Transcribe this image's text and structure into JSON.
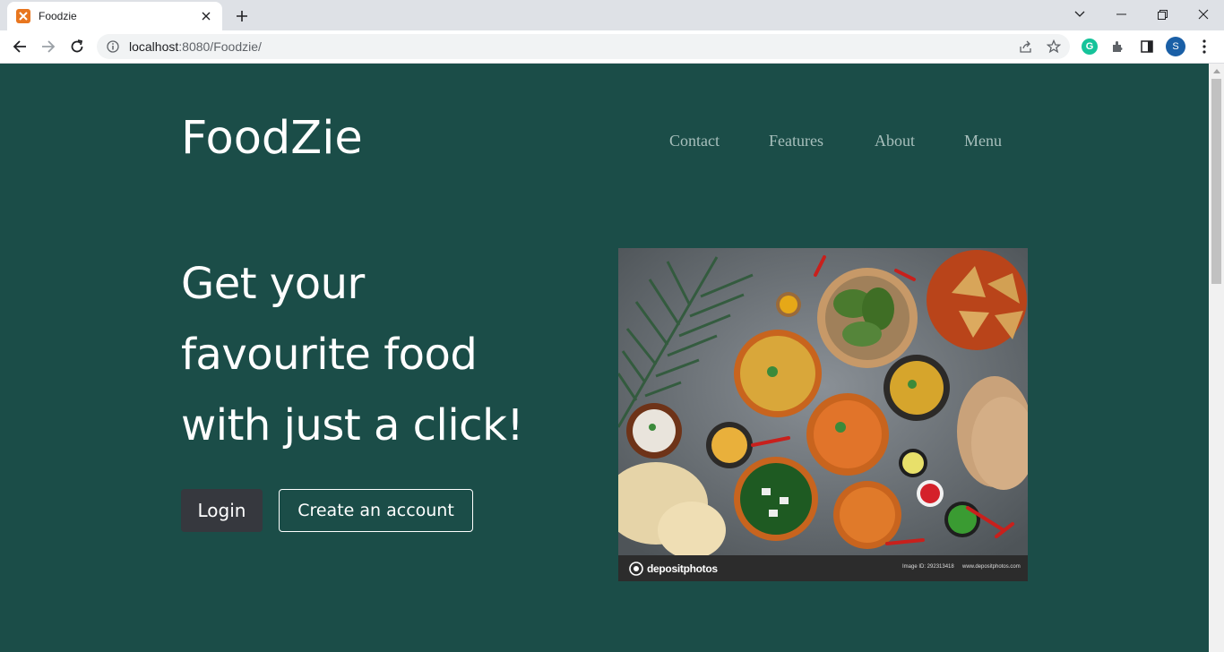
{
  "browser": {
    "tab_title": "Foodzie",
    "url_host": "localhost",
    "url_path": ":8080/Foodzie/",
    "profile_initial": "S",
    "icons": [
      "back-arrow-icon",
      "forward-arrow-icon",
      "reload-icon",
      "info-icon",
      "share-icon",
      "bookmark-star-icon",
      "grammarly-icon",
      "extensions-icon",
      "side-panel-icon",
      "kebab-menu-icon"
    ]
  },
  "header": {
    "brand": "FoodZie",
    "nav": [
      "Contact",
      "Features",
      "About",
      "Menu"
    ]
  },
  "hero": {
    "title_lines": [
      "Get your",
      "favourite food",
      "with just a click!"
    ],
    "login_label": "Login",
    "create_label": "Create an account",
    "image": {
      "description": "Assorted Indian food bowls",
      "watermark_brand": "depositphotos",
      "watermark_id": "Image ID: 292313418",
      "watermark_site": "www.depositphotos.com"
    }
  },
  "colors": {
    "page_bg": "#1b4d48",
    "login_bg": "#36383e",
    "nav_text": "#a7bfbc"
  }
}
